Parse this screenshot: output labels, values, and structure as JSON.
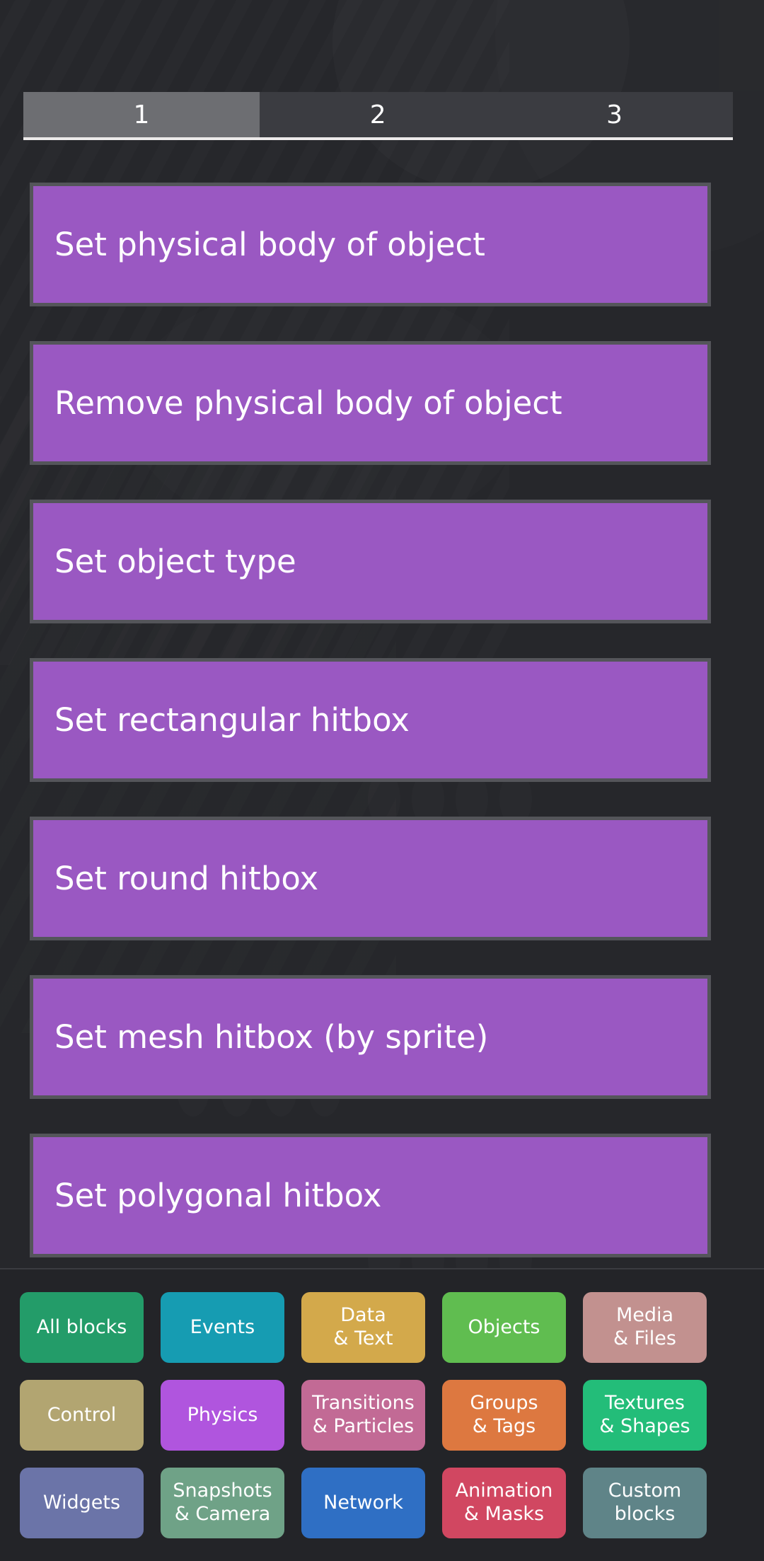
{
  "app": {
    "background_color": "#26272b",
    "panel_color": "#232428"
  },
  "tabs": {
    "items": [
      {
        "label": "1",
        "active": true
      },
      {
        "label": "2",
        "active": false
      },
      {
        "label": "3",
        "active": false
      }
    ],
    "active_color": "#6d6e72",
    "inactive_color": "#3b3c41",
    "underline_color": "#eceaea"
  },
  "blocks": {
    "fill_color": "#9a58c2",
    "border_color": "#54555a",
    "items": [
      {
        "label": "Set physical body of object"
      },
      {
        "label": "Remove physical body of object"
      },
      {
        "label": "Set object type"
      },
      {
        "label": "Set rectangular hitbox"
      },
      {
        "label": "Set round hitbox"
      },
      {
        "label": "Set mesh hitbox (by sprite)"
      },
      {
        "label": "Set polygonal hitbox"
      },
      {
        "label": ""
      }
    ]
  },
  "categories": {
    "rows": [
      [
        {
          "line1": "All blocks",
          "line2": "",
          "color": "#239c69"
        },
        {
          "line1": "Events",
          "line2": "",
          "color": "#169cb2"
        },
        {
          "line1": "Data",
          "line2": "& Text",
          "color": "#d3a94b"
        },
        {
          "line1": "Objects",
          "line2": "",
          "color": "#60bd50"
        },
        {
          "line1": "Media",
          "line2": "& Files",
          "color": "#c2918f"
        }
      ],
      [
        {
          "line1": "Control",
          "line2": "",
          "color": "#b2a571"
        },
        {
          "line1": "Physics",
          "line2": "",
          "color": "#b055de"
        },
        {
          "line1": "Transitions",
          "line2": "& Particles",
          "color": "#c26a95"
        },
        {
          "line1": "Groups",
          "line2": "& Tags",
          "color": "#dd7840"
        },
        {
          "line1": "Textures",
          "line2": "& Shapes",
          "color": "#23bd79"
        }
      ],
      [
        {
          "line1": "Widgets",
          "line2": "",
          "color": "#6b74a8"
        },
        {
          "line1": "Snapshots",
          "line2": "& Camera",
          "color": "#6fa287"
        },
        {
          "line1": "Network",
          "line2": "",
          "color": "#2f6fc4"
        },
        {
          "line1": "Animation",
          "line2": "& Masks",
          "color": "#d14761"
        },
        {
          "line1": "Custom",
          "line2": "blocks",
          "color": "#5f8488"
        }
      ]
    ]
  }
}
